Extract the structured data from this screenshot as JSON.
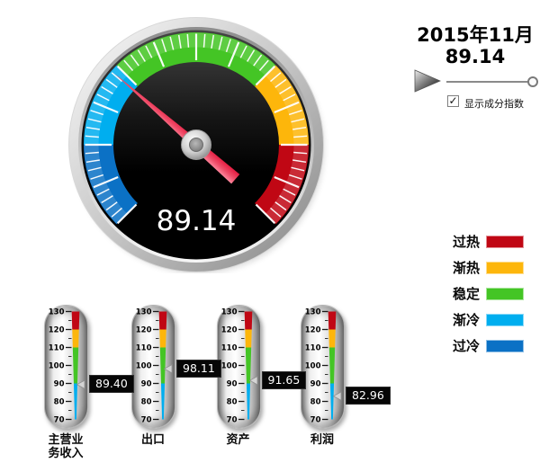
{
  "ui": {
    "header": {
      "date": "2015年11月",
      "value": "89.14"
    },
    "controls": {
      "play_button": "play",
      "checkbox_glyph": "✓",
      "checkbox_label": "显示成分指数",
      "checkbox_checked": true,
      "slider_handle_position": "right"
    },
    "legend_items": [
      {
        "label": "过热",
        "color": "#c00714"
      },
      {
        "label": "渐热",
        "color": "#fdb60b"
      },
      {
        "label": "稳定",
        "color": "#44c525"
      },
      {
        "label": "渐冷",
        "color": "#00aeef"
      },
      {
        "label": "过冷",
        "color": "#0b71c5"
      }
    ]
  },
  "chart_data": {
    "type": "gauge",
    "title": "2015年11月",
    "scale": {
      "min": 70,
      "max": 130,
      "major_tick": 5,
      "minor_tick": 1,
      "start_angle": -135,
      "end_angle": 135
    },
    "bands": [
      {
        "label": "过冷",
        "range": [
          70,
          80
        ],
        "color": "#0b71c5"
      },
      {
        "label": "渐冷",
        "range": [
          80,
          90
        ],
        "color": "#00aeef"
      },
      {
        "label": "稳定",
        "range": [
          90,
          110
        ],
        "color": "#44c525"
      },
      {
        "label": "渐热",
        "range": [
          110,
          120
        ],
        "color": "#fdb60b"
      },
      {
        "label": "过热",
        "range": [
          120,
          130
        ],
        "color": "#c00714"
      }
    ],
    "main_gauge": {
      "value": 89.14,
      "display": "89.14"
    },
    "thermometers": {
      "scale": {
        "min": 70,
        "max": 130,
        "major_tick": 10,
        "minor_tick": 5
      },
      "bands": [
        {
          "range": [
            120,
            130
          ],
          "color": "#c00714"
        },
        {
          "range": [
            110,
            120
          ],
          "color": "#fdb60b"
        },
        {
          "range": [
            90,
            110
          ],
          "color": "#44c525"
        },
        {
          "range": [
            70,
            90
          ],
          "color": "#00aeef"
        }
      ],
      "items": [
        {
          "label_lines": [
            "主营业",
            "务收入"
          ],
          "value": 89.4,
          "display": "89.40"
        },
        {
          "label_lines": [
            "出口"
          ],
          "value": 98.11,
          "display": "98.11"
        },
        {
          "label_lines": [
            "资产"
          ],
          "value": 91.65,
          "display": "91.65"
        },
        {
          "label_lines": [
            "利润"
          ],
          "value": 82.96,
          "display": "82.96"
        }
      ]
    }
  }
}
